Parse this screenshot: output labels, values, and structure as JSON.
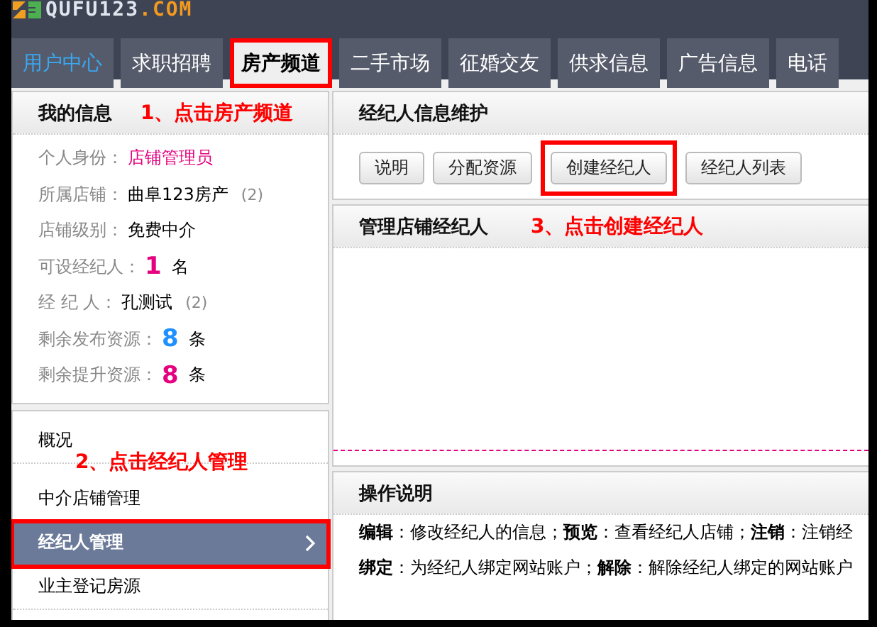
{
  "logo": {
    "name": "QUFU123",
    "suffix": ".COM"
  },
  "nav_tabs": [
    {
      "label": "用户中心",
      "kind": "home",
      "selected": false,
      "highlighted": false
    },
    {
      "label": "求职招聘",
      "kind": "channel",
      "selected": false,
      "highlighted": false
    },
    {
      "label": "房产频道",
      "kind": "channel",
      "selected": true,
      "highlighted": true
    },
    {
      "label": "二手市场",
      "kind": "channel",
      "selected": false,
      "highlighted": false
    },
    {
      "label": "征婚交友",
      "kind": "channel",
      "selected": false,
      "highlighted": false
    },
    {
      "label": "供求信息",
      "kind": "channel",
      "selected": false,
      "highlighted": false
    },
    {
      "label": "广告信息",
      "kind": "channel",
      "selected": false,
      "highlighted": false
    },
    {
      "label": "电话",
      "kind": "channel",
      "selected": false,
      "highlighted": false
    }
  ],
  "my_info": {
    "title": "我的信息",
    "annotation": "1、点击房产频道",
    "rows": [
      {
        "kind": "role",
        "label": "个人身份：",
        "value": "店铺管理员"
      },
      {
        "kind": "text",
        "label": "所属店铺：",
        "value": "曲阜123房产",
        "note": "(2)"
      },
      {
        "kind": "text",
        "label": "店铺级别：",
        "value": "免费中介"
      },
      {
        "kind": "count",
        "label": "可设经纪人：",
        "number": "1",
        "color": "#e4007f",
        "unit": "名"
      },
      {
        "kind": "text",
        "label": "经 纪 人：",
        "value": "孔测试",
        "note": "(2)"
      },
      {
        "kind": "count",
        "label": "剩余发布资源：",
        "number": "8",
        "color": "#1e90ff",
        "unit": "条"
      },
      {
        "kind": "count",
        "label": "剩余提升资源：",
        "number": "8",
        "color": "#e4007f",
        "unit": "条"
      }
    ]
  },
  "side_menu": {
    "annotation": "2、点击经纪人管理",
    "items": [
      {
        "label": "概况",
        "selected": false,
        "highlighted": false
      },
      {
        "label": "中介店铺管理",
        "selected": false,
        "highlighted": false
      },
      {
        "label": "经纪人管理",
        "selected": true,
        "highlighted": true
      },
      {
        "label": "业主登记房源",
        "selected": false,
        "highlighted": false
      }
    ]
  },
  "agent_panel": {
    "title": "经纪人信息维护",
    "buttons": [
      {
        "label": "说明",
        "highlighted": false
      },
      {
        "label": "分配资源",
        "highlighted": false
      },
      {
        "label": "创建经纪人",
        "highlighted": true
      },
      {
        "label": "经纪人列表",
        "highlighted": false
      }
    ]
  },
  "manage_panel": {
    "title": "管理店铺经纪人",
    "annotation": "3、点击创建经纪人"
  },
  "help_panel": {
    "title": "操作说明",
    "lines": [
      "**编辑**：修改经纪人的信息； **预览**：查看经纪人店铺； **注销**：注销经",
      "**绑定**：为经纪人绑定网站账户； **解除**：解除经纪人绑定的网站账户"
    ]
  }
}
